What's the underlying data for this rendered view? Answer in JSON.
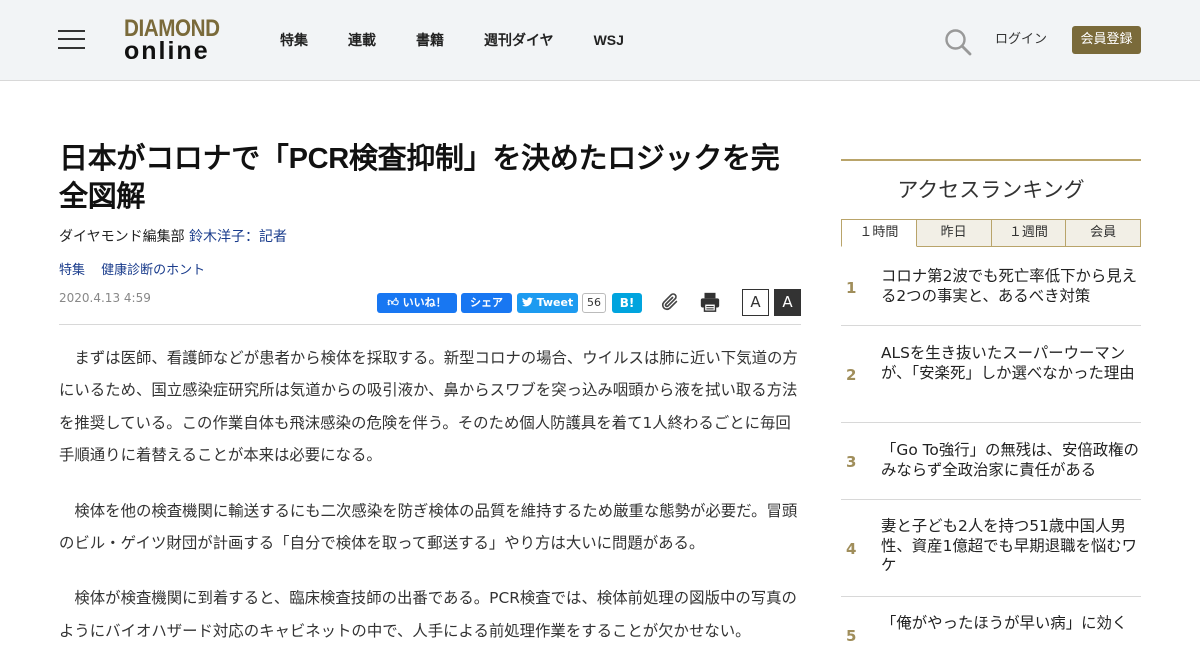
{
  "header": {
    "logo_top": "DIAMOND",
    "logo_bottom": "online",
    "nav": [
      "特集",
      "連載",
      "書籍",
      "週刊ダイヤ",
      "WSJ"
    ],
    "login": "ログイン",
    "register": "会員登録"
  },
  "article": {
    "title": "日本がコロナで「PCR検査抑制」を決めたロジックを完全図解",
    "dept": "ダイヤモンド編集部",
    "author": "鈴木洋子：記者",
    "tags": [
      "特集",
      "健康診断のホント"
    ],
    "date": "2020.4.13 4:59",
    "share": {
      "like": "いいね！",
      "share": "シェア",
      "tweet": "Tweet",
      "tweet_count": "56",
      "hatena": "B!"
    },
    "font_small": "A",
    "font_large": "A",
    "paragraphs": [
      "まずは医師、看護師などが患者から検体を採取する。新型コロナの場合、ウイルスは肺に近い下気道の方にいるため、国立感染症研究所は気道からの吸引液か、鼻からスワブを突っ込み咽頭から液を拭い取る方法を推奨している。この作業自体も飛沫感染の危険を伴う。そのため個人防護具を着て1人終わるごとに毎回手順通りに着替えることが本来は必要になる。",
      "検体を他の検査機関に輸送するにも二次感染を防ぎ検体の品質を維持するため厳重な態勢が必要だ。冒頭のビル・ゲイツ財団が計画する「自分で検体を取って郵送する」やり方は大いに問題がある。",
      "検体が検査機関に到着すると、臨床検査技師の出番である。PCR検査では、検体前処理の図版中の写真のようにバイオハザード対応のキャビネットの中で、人手による前処理作業をすることが欠かせない。"
    ]
  },
  "ranking": {
    "title": "アクセスランキング",
    "tabs": [
      "１時間",
      "昨日",
      "１週間",
      "会員"
    ],
    "items": [
      {
        "num": "1",
        "text": "コロナ第2波でも死亡率低下から見える2つの事実と、あるべき対策"
      },
      {
        "num": "2",
        "text": "ALSを生き抜いたスーパーウーマンが、「安楽死」しか選べなかった理由"
      },
      {
        "num": "3",
        "text": "「Go To強行」の無残は、安倍政権のみならず全政治家に責任がある"
      },
      {
        "num": "4",
        "text": "妻と子ども2人を持つ51歳中国人男性、資産1億超でも早期退職を悩むワケ"
      },
      {
        "num": "5",
        "text": "「俺がやったほうが早い病」に効く"
      }
    ]
  }
}
